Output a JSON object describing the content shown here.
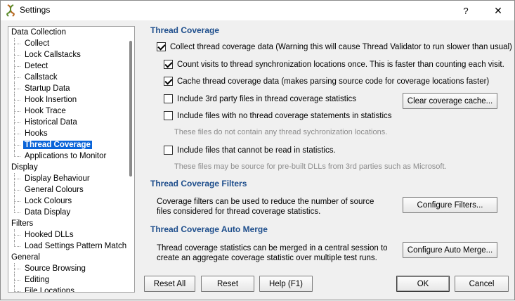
{
  "window": {
    "title": "Settings",
    "help_glyph": "?",
    "close_glyph": "✕"
  },
  "tree": {
    "items": [
      {
        "label": "Data Collection",
        "level": 0
      },
      {
        "label": "Collect",
        "level": 1
      },
      {
        "label": "Lock Callstacks",
        "level": 1
      },
      {
        "label": "Detect",
        "level": 1
      },
      {
        "label": "Callstack",
        "level": 1
      },
      {
        "label": "Startup Data",
        "level": 1
      },
      {
        "label": "Hook Insertion",
        "level": 1
      },
      {
        "label": "Hook Trace",
        "level": 1
      },
      {
        "label": "Historical Data",
        "level": 1
      },
      {
        "label": "Hooks",
        "level": 1
      },
      {
        "label": "Thread Coverage",
        "level": 1,
        "selected": true
      },
      {
        "label": "Applications to Monitor",
        "level": 1,
        "last": true
      },
      {
        "label": "Display",
        "level": 0
      },
      {
        "label": "Display Behaviour",
        "level": 1
      },
      {
        "label": "General Colours",
        "level": 1
      },
      {
        "label": "Lock Colours",
        "level": 1
      },
      {
        "label": "Data Display",
        "level": 1,
        "last": true
      },
      {
        "label": "Filters",
        "level": 0
      },
      {
        "label": "Hooked DLLs",
        "level": 1
      },
      {
        "label": "Load Settings Pattern Match",
        "level": 1,
        "last": true
      },
      {
        "label": "General",
        "level": 0
      },
      {
        "label": "Source Browsing",
        "level": 1
      },
      {
        "label": "Editing",
        "level": 1
      },
      {
        "label": "File Locations",
        "level": 1
      }
    ]
  },
  "thread_coverage": {
    "title": "Thread Coverage",
    "collect": {
      "label": "Collect thread coverage data (Warning this will cause Thread Validator to run slower than usual)",
      "checked": true
    },
    "count_once": {
      "label": "Count visits to thread synchronization locations once. This is faster than counting each visit.",
      "checked": true
    },
    "cache": {
      "label": "Cache thread coverage data (makes parsing source code for coverage locations faster)",
      "checked": true
    },
    "third_party": {
      "label": "Include 3rd party files in thread coverage statistics",
      "checked": false
    },
    "clear_cache_button": "Clear coverage cache...",
    "no_statements": {
      "label": "Include files with no thread coverage statements in statistics",
      "checked": false
    },
    "no_statements_note": "These files do not contain any thread sychronization locations.",
    "unreadable": {
      "label": "Include files that cannot be read in statistics.",
      "checked": false
    },
    "unreadable_note": "These files may be source for pre-built DLLs from 3rd parties such as Microsoft."
  },
  "filters": {
    "title": "Thread Coverage Filters",
    "description": "Coverage filters can be used to reduce the number of source files considered for thread coverage statistics.",
    "button": "Configure Filters..."
  },
  "auto_merge": {
    "title": "Thread Coverage Auto Merge",
    "description": "Thread coverage statistics can be merged in a central session to create an aggregate coverage statistic over multiple test runs.",
    "button": "Configure Auto Merge..."
  },
  "footer": {
    "reset_all": "Reset All",
    "reset": "Reset",
    "help": "Help (F1)",
    "ok": "OK",
    "cancel": "Cancel"
  }
}
